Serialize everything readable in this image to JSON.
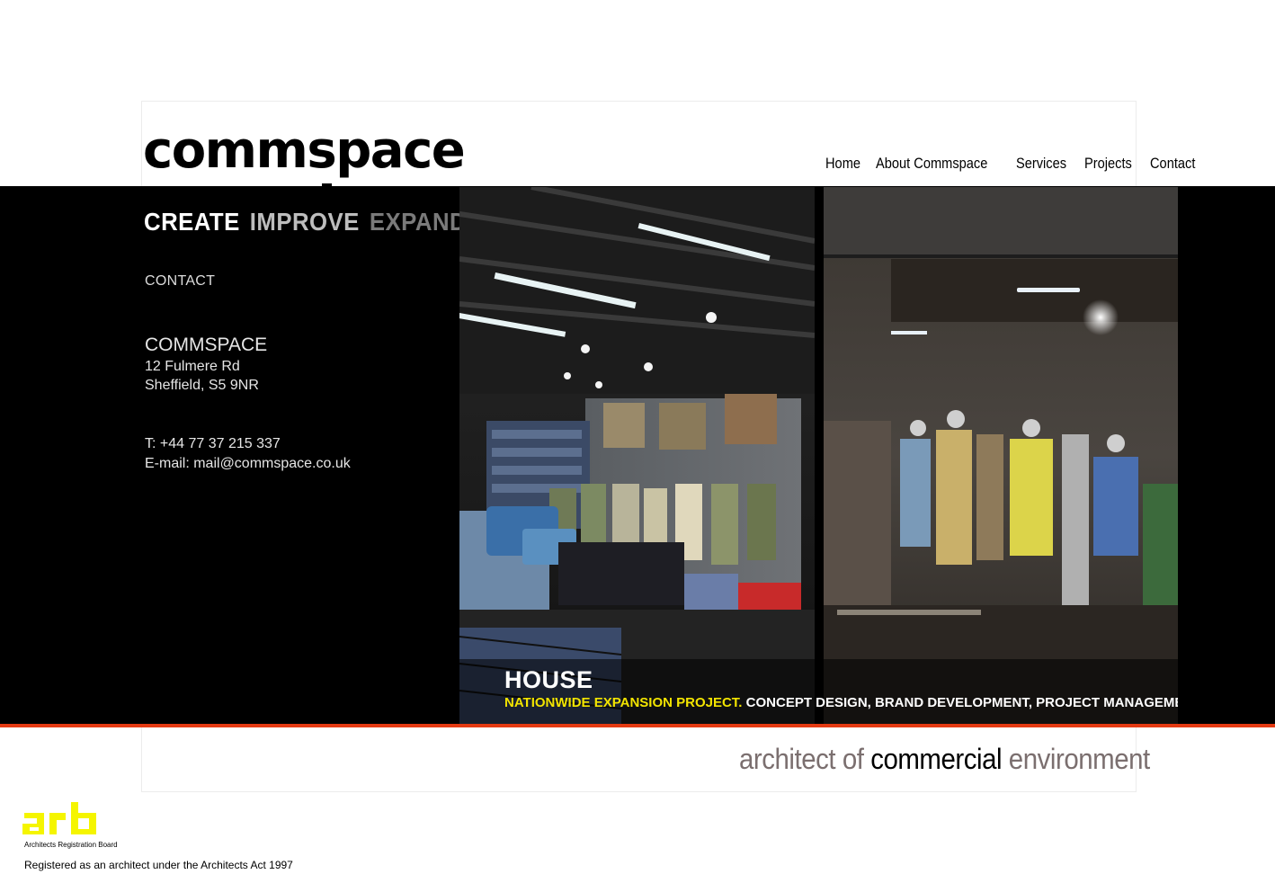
{
  "brand": {
    "logo": "commspace"
  },
  "nav": [
    "Home",
    "About Commspace",
    "Services",
    "Projects",
    "Contact"
  ],
  "slogan": [
    "CREATE",
    "IMPROVE",
    "EXPAND"
  ],
  "contact": {
    "section_label": "CONTACT",
    "company": "COMMSPACE",
    "address_line1": "12 Fulmere Rd",
    "address_line2": "Sheffield, S5 9NR",
    "phone": "T: +44 77 37 215 337",
    "email": "E-mail: mail@commspace.co.uk"
  },
  "project": {
    "title": "HOUSE",
    "highlight": "NATIONWIDE EXPANSION PROJECT.",
    "description": " CONCEPT DESIGN, BRAND DEVELOPMENT, PROJECT MANAGEMENT."
  },
  "tagline": {
    "part1": "architect of ",
    "part2": "commercial",
    "part3": " environment"
  },
  "footer": {
    "arb_logo": "arb",
    "arb_name": "Architects Registration Board",
    "registration": "Registered as an architect under the Architects Act 1997"
  },
  "colors": {
    "accent_line": "#e53a12",
    "highlight_yellow": "#f2e400",
    "arb_yellow": "#f5f500"
  }
}
